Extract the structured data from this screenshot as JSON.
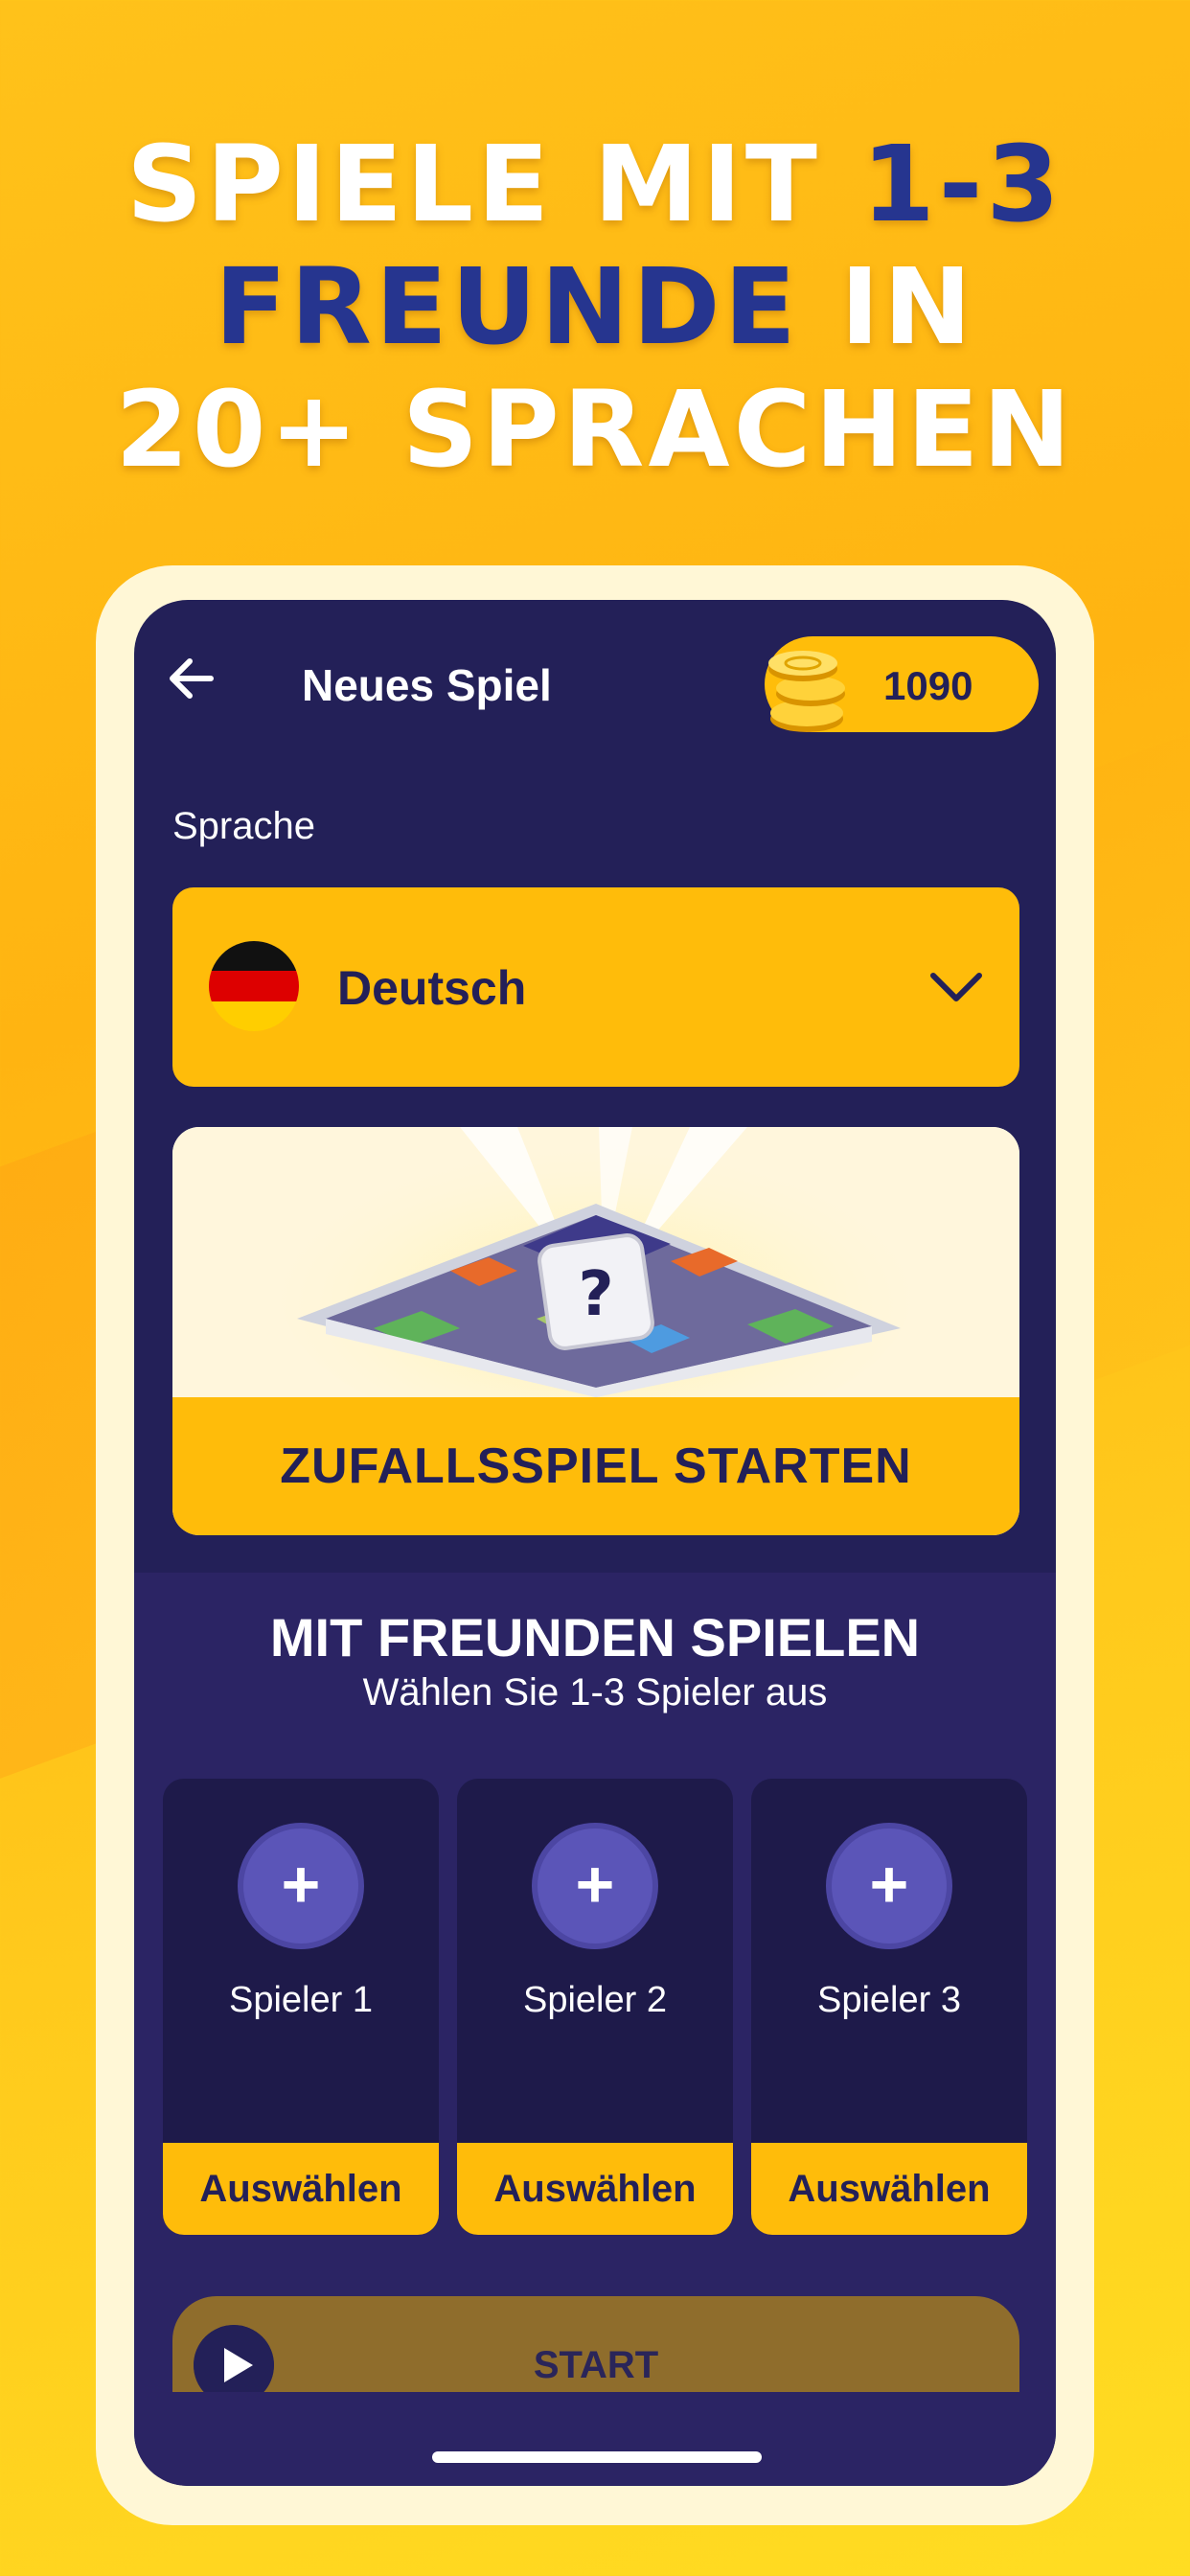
{
  "headline": {
    "line1_white": "SPIELE MIT ",
    "line1_blue": "1-3",
    "line2_blue": "FREUNDE",
    "line2_white": " IN",
    "line3": "20+ SPRACHEN"
  },
  "colors": {
    "background": "#ffc21a",
    "screen": "#232058",
    "accent": "#ffbc0a",
    "headline_blue": "#26358f",
    "add_button": "#5b55b8"
  },
  "app": {
    "title": "Neues Spiel",
    "back_icon": "arrow-left-icon",
    "coins": "1090",
    "coin_icon": "coin-stack-icon"
  },
  "language": {
    "label": "Sprache",
    "selected": "Deutsch",
    "flag_icon": "germany-flag-icon",
    "dropdown_icon": "chevron-down-icon"
  },
  "random_game": {
    "button": "ZUFALLSSPIEL STARTEN",
    "tile_letter": "?"
  },
  "friends": {
    "title": "MIT FREUNDEN SPIELEN",
    "subtitle": "Wählen Sie 1-3 Spieler aus",
    "slots": [
      {
        "name": "Spieler 1",
        "add": "+",
        "button": "Auswählen"
      },
      {
        "name": "Spieler 2",
        "add": "+",
        "button": "Auswählen"
      },
      {
        "name": "Spieler 3",
        "add": "+",
        "button": "Auswählen"
      }
    ]
  },
  "start": {
    "label": "START",
    "play_icon": "play-icon"
  }
}
